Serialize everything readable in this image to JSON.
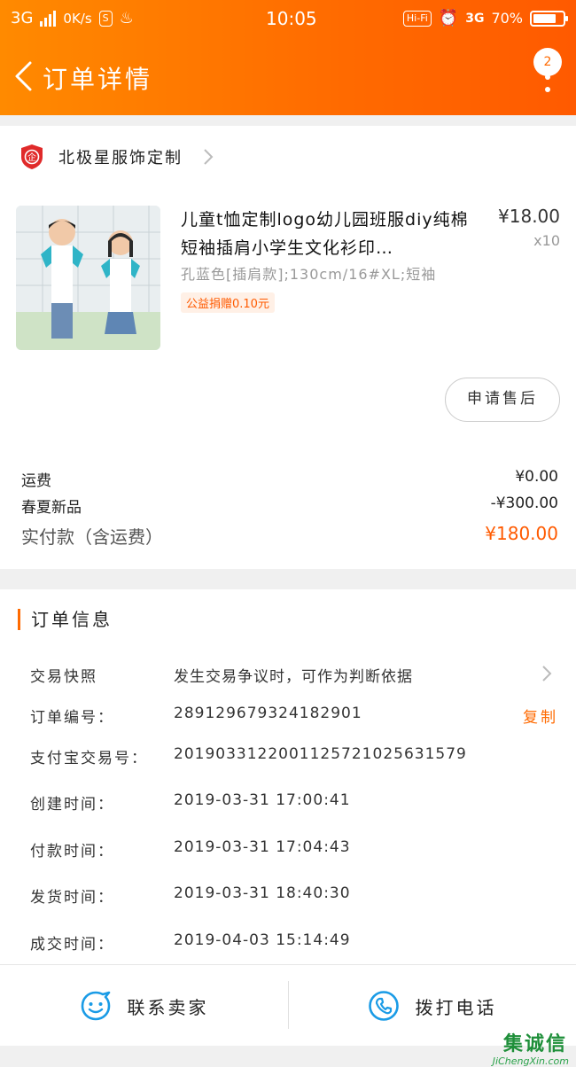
{
  "status_bar": {
    "network": "3G",
    "speed": "0K/s",
    "time": "10:05",
    "hifi": "Hi-Fi",
    "network2": "3G",
    "battery": "70%"
  },
  "nav": {
    "title": "订单详情",
    "badge_count": "2"
  },
  "store": {
    "name": "北极星服饰定制"
  },
  "product": {
    "title": "儿童t恤定制logo幼儿园班服diy纯棉短袖插肩小学生文化衫印…",
    "price": "¥18.00",
    "qty": "x10",
    "spec": "孔蓝色[插肩款];130cm/16#XL;短袖",
    "tag": "公益捐赠0.10元",
    "after_sale_label": "申请售后"
  },
  "fees": [
    {
      "label": "运费",
      "value": "¥0.00"
    },
    {
      "label": "春夏新品",
      "value": "-¥300.00"
    },
    {
      "label": "实付款（含运费）",
      "value": "¥180.00"
    }
  ],
  "order_info": {
    "title": "订单信息",
    "rows": [
      {
        "label": "交易快照",
        "value": "发生交易争议时，可作为判断依据"
      },
      {
        "label": "订单编号：",
        "value": "289129679324182901",
        "action": "复制"
      },
      {
        "label": "支付宝交易号：",
        "value": "2019033122001125721025631579"
      },
      {
        "label": "创建时间：",
        "value": "2019-03-31 17:00:41"
      },
      {
        "label": "付款时间：",
        "value": "2019-03-31 17:04:43"
      },
      {
        "label": "发货时间：",
        "value": "2019-03-31 18:40:30"
      },
      {
        "label": "成交时间：",
        "value": "2019-04-03 15:14:49"
      }
    ]
  },
  "bottom_bar": {
    "contact_label": "联系卖家",
    "call_label": "拨打电话"
  },
  "watermark": {
    "brand": "集诚信",
    "url": "JiChengXin.com"
  },
  "colors": {
    "accent": "#ff6a00",
    "header_start": "#ff8a00",
    "icon_blue": "#1a9be6"
  }
}
